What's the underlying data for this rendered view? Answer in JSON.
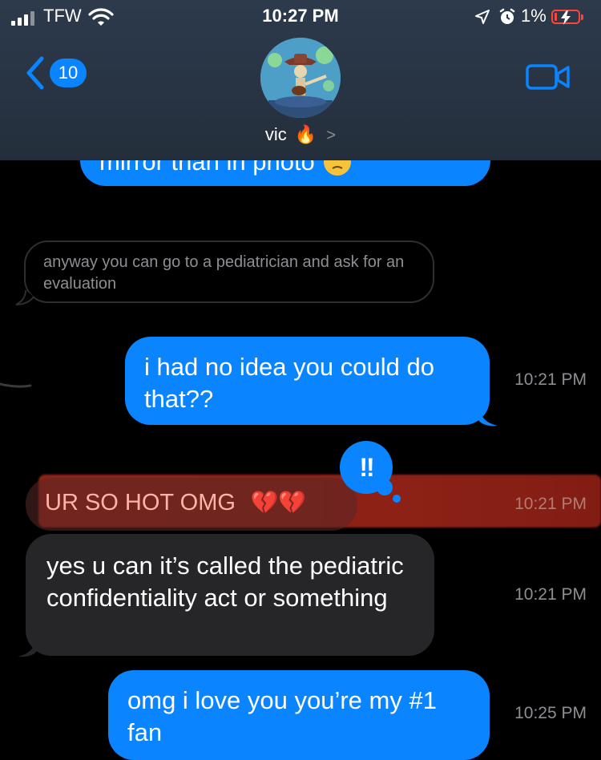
{
  "status": {
    "carrier": "TFW",
    "time": "10:27 PM",
    "battery_pct": "1%"
  },
  "header": {
    "back_badge": "10",
    "contact_name": "vic",
    "contact_emoji": "🔥",
    "contact_chevron": ">"
  },
  "messages": {
    "partial_top": "mirror than in photo",
    "quoted": "anyway you can go to a pediatrician and ask for an evaluation",
    "m1": {
      "text": "i had no idea you could do that??",
      "time": "10:21 PM"
    },
    "m2": {
      "text": "UR SO HOT OMG",
      "emoji": "💔💔",
      "time": "10:21 PM",
      "reaction": "!!"
    },
    "m3": {
      "text": "yes u can it’s called the pediatric confidentiality act or something",
      "time": "10:21 PM"
    },
    "m4": {
      "text": "omg i love you you’re my #1 fan",
      "time": "10:25 PM"
    }
  },
  "colors": {
    "sent_bubble": "#0a84ff",
    "received_bubble": "#262628",
    "timestamp": "#8e8e93",
    "highlight": "#b8301f"
  }
}
